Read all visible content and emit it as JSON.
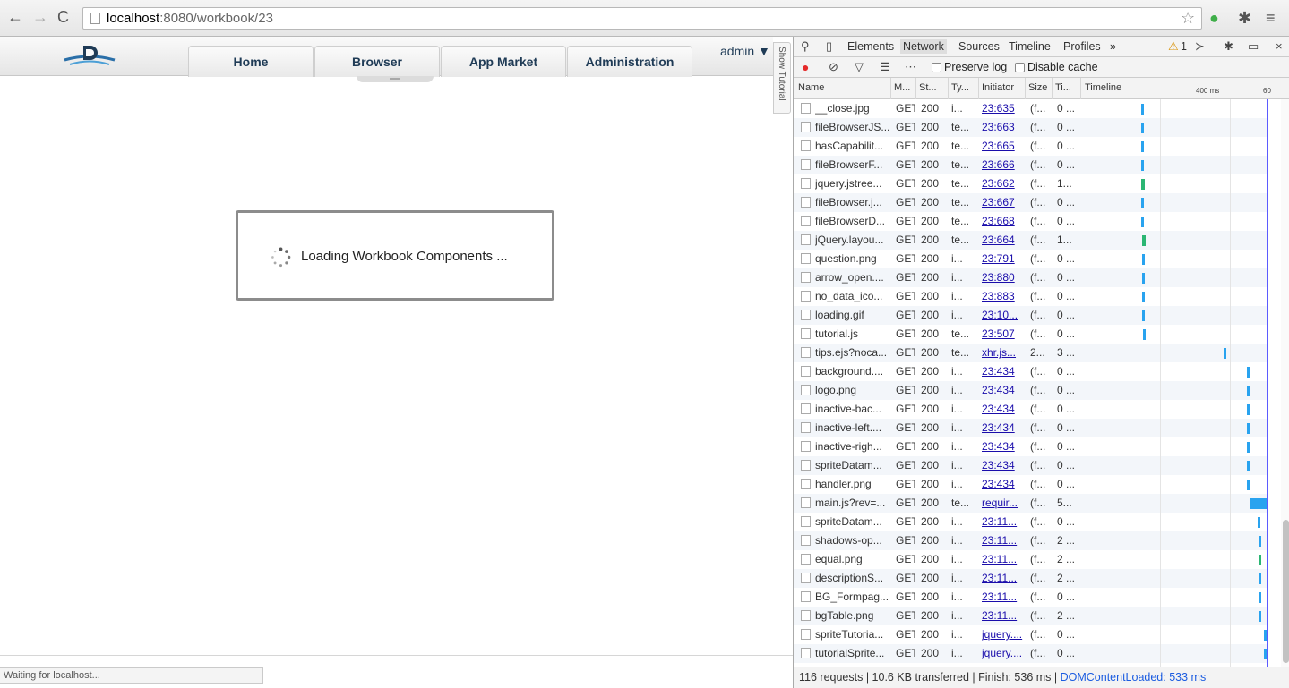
{
  "browser": {
    "url_host": "localhost",
    "url_path": ":8080/workbook/23"
  },
  "app": {
    "nav": [
      "Home",
      "Browser",
      "App Market",
      "Administration"
    ],
    "user": "admin ▼",
    "tutorial_tab": "Show Tutorial",
    "loading_text": "Loading Workbook Components ...",
    "status": "Waiting for localhost..."
  },
  "devtools": {
    "tabs": [
      "Elements",
      "Network",
      "Sources",
      "Timeline",
      "Profiles",
      "»"
    ],
    "active_tab": "Network",
    "warning_count": "1",
    "preserve_log": "Preserve log",
    "disable_cache": "Disable cache",
    "columns": [
      "Name",
      "M...",
      "St...",
      "Ty...",
      "Initiator",
      "Size",
      "Ti...",
      "Timeline"
    ],
    "ticks": [
      "400 ms",
      "60"
    ],
    "rows": [
      {
        "name": "__close.jpg",
        "m": "GET",
        "st": "200",
        "ty": "i...",
        "init": "23:635",
        "size": "(f...",
        "ti": "0 ..."
      },
      {
        "name": "fileBrowserJS...",
        "m": "GET",
        "st": "200",
        "ty": "te...",
        "init": "23:663",
        "size": "(f...",
        "ti": "0 ..."
      },
      {
        "name": "hasCapabilit...",
        "m": "GET",
        "st": "200",
        "ty": "te...",
        "init": "23:665",
        "size": "(f...",
        "ti": "0 ..."
      },
      {
        "name": "fileBrowserF...",
        "m": "GET",
        "st": "200",
        "ty": "te...",
        "init": "23:666",
        "size": "(f...",
        "ti": "0 ..."
      },
      {
        "name": "jquery.jstree...",
        "m": "GET",
        "st": "200",
        "ty": "te...",
        "init": "23:662",
        "size": "(f...",
        "ti": "1..."
      },
      {
        "name": "fileBrowser.j...",
        "m": "GET",
        "st": "200",
        "ty": "te...",
        "init": "23:667",
        "size": "(f...",
        "ti": "0 ..."
      },
      {
        "name": "fileBrowserD...",
        "m": "GET",
        "st": "200",
        "ty": "te...",
        "init": "23:668",
        "size": "(f...",
        "ti": "0 ..."
      },
      {
        "name": "jQuery.layou...",
        "m": "GET",
        "st": "200",
        "ty": "te...",
        "init": "23:664",
        "size": "(f...",
        "ti": "1..."
      },
      {
        "name": "question.png",
        "m": "GET",
        "st": "200",
        "ty": "i...",
        "init": "23:791",
        "size": "(f...",
        "ti": "0 ..."
      },
      {
        "name": "arrow_open....",
        "m": "GET",
        "st": "200",
        "ty": "i...",
        "init": "23:880",
        "size": "(f...",
        "ti": "0 ..."
      },
      {
        "name": "no_data_ico...",
        "m": "GET",
        "st": "200",
        "ty": "i...",
        "init": "23:883",
        "size": "(f...",
        "ti": "0 ..."
      },
      {
        "name": "loading.gif",
        "m": "GET",
        "st": "200",
        "ty": "i...",
        "init": "23:10...",
        "size": "(f...",
        "ti": "0 ..."
      },
      {
        "name": "tutorial.js",
        "m": "GET",
        "st": "200",
        "ty": "te...",
        "init": "23:507",
        "size": "(f...",
        "ti": "0 ..."
      },
      {
        "name": "tips.ejs?noca...",
        "m": "GET",
        "st": "200",
        "ty": "te...",
        "init": "xhr.js...",
        "size": "2...",
        "ti": "3 ..."
      },
      {
        "name": "background....",
        "m": "GET",
        "st": "200",
        "ty": "i...",
        "init": "23:434",
        "size": "(f...",
        "ti": "0 ..."
      },
      {
        "name": "logo.png",
        "m": "GET",
        "st": "200",
        "ty": "i...",
        "init": "23:434",
        "size": "(f...",
        "ti": "0 ..."
      },
      {
        "name": "inactive-bac...",
        "m": "GET",
        "st": "200",
        "ty": "i...",
        "init": "23:434",
        "size": "(f...",
        "ti": "0 ..."
      },
      {
        "name": "inactive-left....",
        "m": "GET",
        "st": "200",
        "ty": "i...",
        "init": "23:434",
        "size": "(f...",
        "ti": "0 ..."
      },
      {
        "name": "inactive-righ...",
        "m": "GET",
        "st": "200",
        "ty": "i...",
        "init": "23:434",
        "size": "(f...",
        "ti": "0 ..."
      },
      {
        "name": "spriteDatam...",
        "m": "GET",
        "st": "200",
        "ty": "i...",
        "init": "23:434",
        "size": "(f...",
        "ti": "0 ..."
      },
      {
        "name": "handler.png",
        "m": "GET",
        "st": "200",
        "ty": "i...",
        "init": "23:434",
        "size": "(f...",
        "ti": "0 ..."
      },
      {
        "name": "main.js?rev=...",
        "m": "GET",
        "st": "200",
        "ty": "te...",
        "init": "requir...",
        "size": "(f...",
        "ti": "5..."
      },
      {
        "name": "spriteDatam...",
        "m": "GET",
        "st": "200",
        "ty": "i...",
        "init": "23:11...",
        "size": "(f...",
        "ti": "0 ..."
      },
      {
        "name": "shadows-op...",
        "m": "GET",
        "st": "200",
        "ty": "i...",
        "init": "23:11...",
        "size": "(f...",
        "ti": "2 ..."
      },
      {
        "name": "equal.png",
        "m": "GET",
        "st": "200",
        "ty": "i...",
        "init": "23:11...",
        "size": "(f...",
        "ti": "2 ..."
      },
      {
        "name": "descriptionS...",
        "m": "GET",
        "st": "200",
        "ty": "i...",
        "init": "23:11...",
        "size": "(f...",
        "ti": "2 ..."
      },
      {
        "name": "BG_Formpag...",
        "m": "GET",
        "st": "200",
        "ty": "i...",
        "init": "23:11...",
        "size": "(f...",
        "ti": "0 ..."
      },
      {
        "name": "bgTable.png",
        "m": "GET",
        "st": "200",
        "ty": "i...",
        "init": "23:11...",
        "size": "(f...",
        "ti": "2 ..."
      },
      {
        "name": "spriteTutoria...",
        "m": "GET",
        "st": "200",
        "ty": "i...",
        "init": "jquery....",
        "size": "(f...",
        "ti": "0 ..."
      },
      {
        "name": "tutorialSprite...",
        "m": "GET",
        "st": "200",
        "ty": "i...",
        "init": "jquery....",
        "size": "(f...",
        "ti": "0 ..."
      }
    ],
    "footer_summary": "116 requests | 10.6 KB transferred | Finish: 536 ms |",
    "footer_dcl": "DOMContentLoaded: 533 ms"
  }
}
